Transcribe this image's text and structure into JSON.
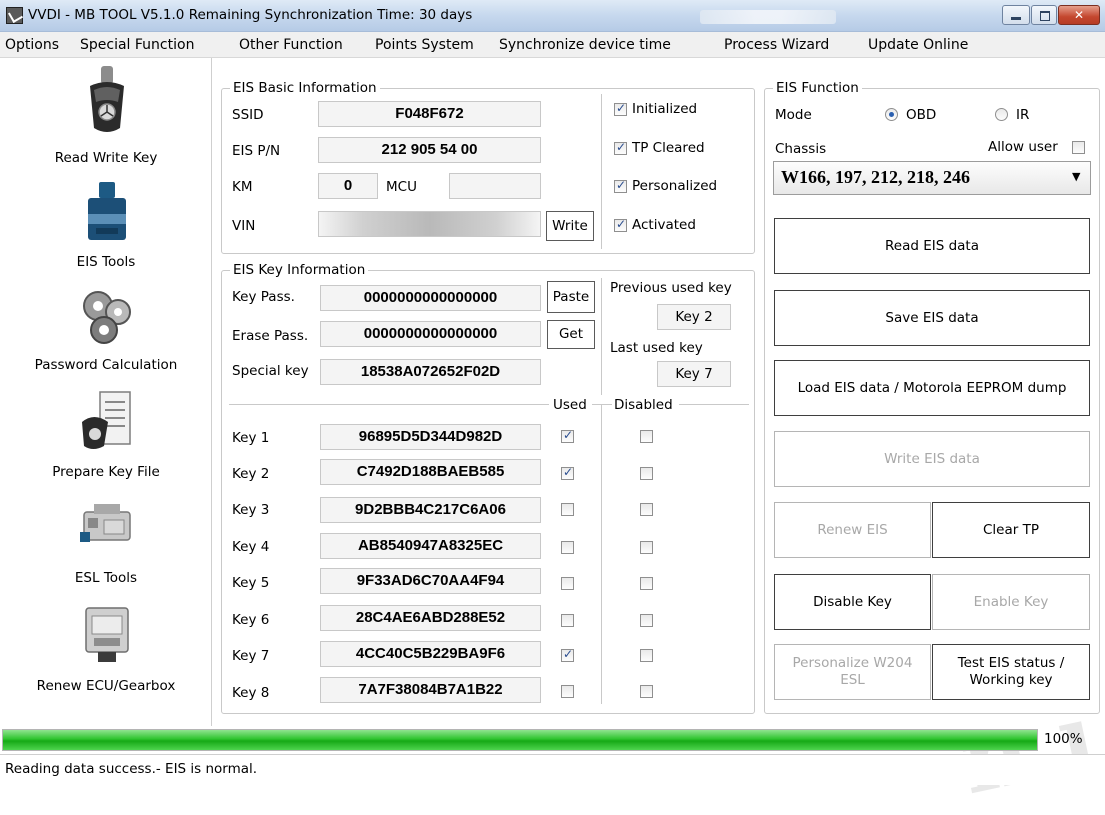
{
  "window": {
    "title": "VVDI - MB TOOL V5.1.0    Remaining Synchronization Time: 30 days"
  },
  "menu": [
    "Options",
    "Special Function",
    "Other Function",
    "Points System",
    "Synchronize device time",
    "Process Wizard",
    "Update Online"
  ],
  "nav": [
    {
      "label": "Read Write Key",
      "icon": "car-key-icon"
    },
    {
      "label": "EIS Tools",
      "icon": "eis-module-icon"
    },
    {
      "label": "Password Calculation",
      "icon": "gears-icon"
    },
    {
      "label": "Prepare Key File",
      "icon": "key-document-icon"
    },
    {
      "label": "ESL Tools",
      "icon": "steering-lock-icon"
    },
    {
      "label": "Renew ECU/Gearbox",
      "icon": "ecu-module-icon"
    }
  ],
  "eis_basic": {
    "title": "EIS Basic Information",
    "ssid_label": "SSID",
    "ssid": "F048F672",
    "pn_label": "EIS P/N",
    "pn": "212 905 54 00",
    "km_label": "KM",
    "km": "0",
    "mcu_label": "MCU",
    "mcu": "",
    "vin_label": "VIN",
    "vin": "",
    "write_label": "Write",
    "flags": [
      {
        "label": "Initialized",
        "checked": true
      },
      {
        "label": "TP Cleared",
        "checked": true
      },
      {
        "label": "Personalized",
        "checked": true
      },
      {
        "label": "Activated",
        "checked": true
      }
    ]
  },
  "eis_key": {
    "title": "EIS Key Information",
    "key_pass_label": "Key Pass.",
    "key_pass": "0000000000000000",
    "paste_label": "Paste",
    "erase_pass_label": "Erase Pass.",
    "erase_pass": "0000000000000000",
    "get_label": "Get",
    "special_key_label": "Special key",
    "special_key": "18538A072652F02D",
    "prev_key_label": "Previous used key",
    "prev_key": "Key 2",
    "last_key_label": "Last used key",
    "last_key": "Key 7",
    "used_label": "Used",
    "disabled_label": "Disabled",
    "keys": [
      {
        "label": "Key 1",
        "value": "96895D5D344D982D",
        "used": true,
        "disabled": false
      },
      {
        "label": "Key 2",
        "value": "C7492D188BAEB585",
        "used": true,
        "disabled": false
      },
      {
        "label": "Key 3",
        "value": "9D2BBB4C217C6A06",
        "used": false,
        "disabled": false
      },
      {
        "label": "Key 4",
        "value": "AB8540947A8325EC",
        "used": false,
        "disabled": false
      },
      {
        "label": "Key 5",
        "value": "9F33AD6C70AA4F94",
        "used": false,
        "disabled": false
      },
      {
        "label": "Key 6",
        "value": "28C4AE6ABD288E52",
        "used": false,
        "disabled": false
      },
      {
        "label": "Key 7",
        "value": "4CC40C5B229BA9F6",
        "used": true,
        "disabled": false
      },
      {
        "label": "Key 8",
        "value": "7A7F38084B7A1B22",
        "used": false,
        "disabled": false
      }
    ]
  },
  "eis_function": {
    "title": "EIS Function",
    "mode_label": "Mode",
    "mode_obd": "OBD",
    "mode_ir": "IR",
    "mode_selected": "OBD",
    "chassis_label": "Chassis",
    "allow_user_label": "Allow user",
    "chassis_value": "W166, 197, 212, 218, 246",
    "read_label": "Read EIS data",
    "save_label": "Save EIS data",
    "load_label": "Load EIS data / Motorola EEPROM dump",
    "write_label": "Write EIS data",
    "renew_label": "Renew EIS",
    "clear_tp_label": "Clear TP",
    "disable_key_label": "Disable Key",
    "enable_key_label": "Enable Key",
    "personalize_label": "Personalize W204 ESL",
    "test_status_label": "Test EIS status / Working key"
  },
  "progress": {
    "value": 100,
    "text": "100%"
  },
  "status": "Reading data success.- EIS is normal.",
  "watermark": "n.ı.s"
}
